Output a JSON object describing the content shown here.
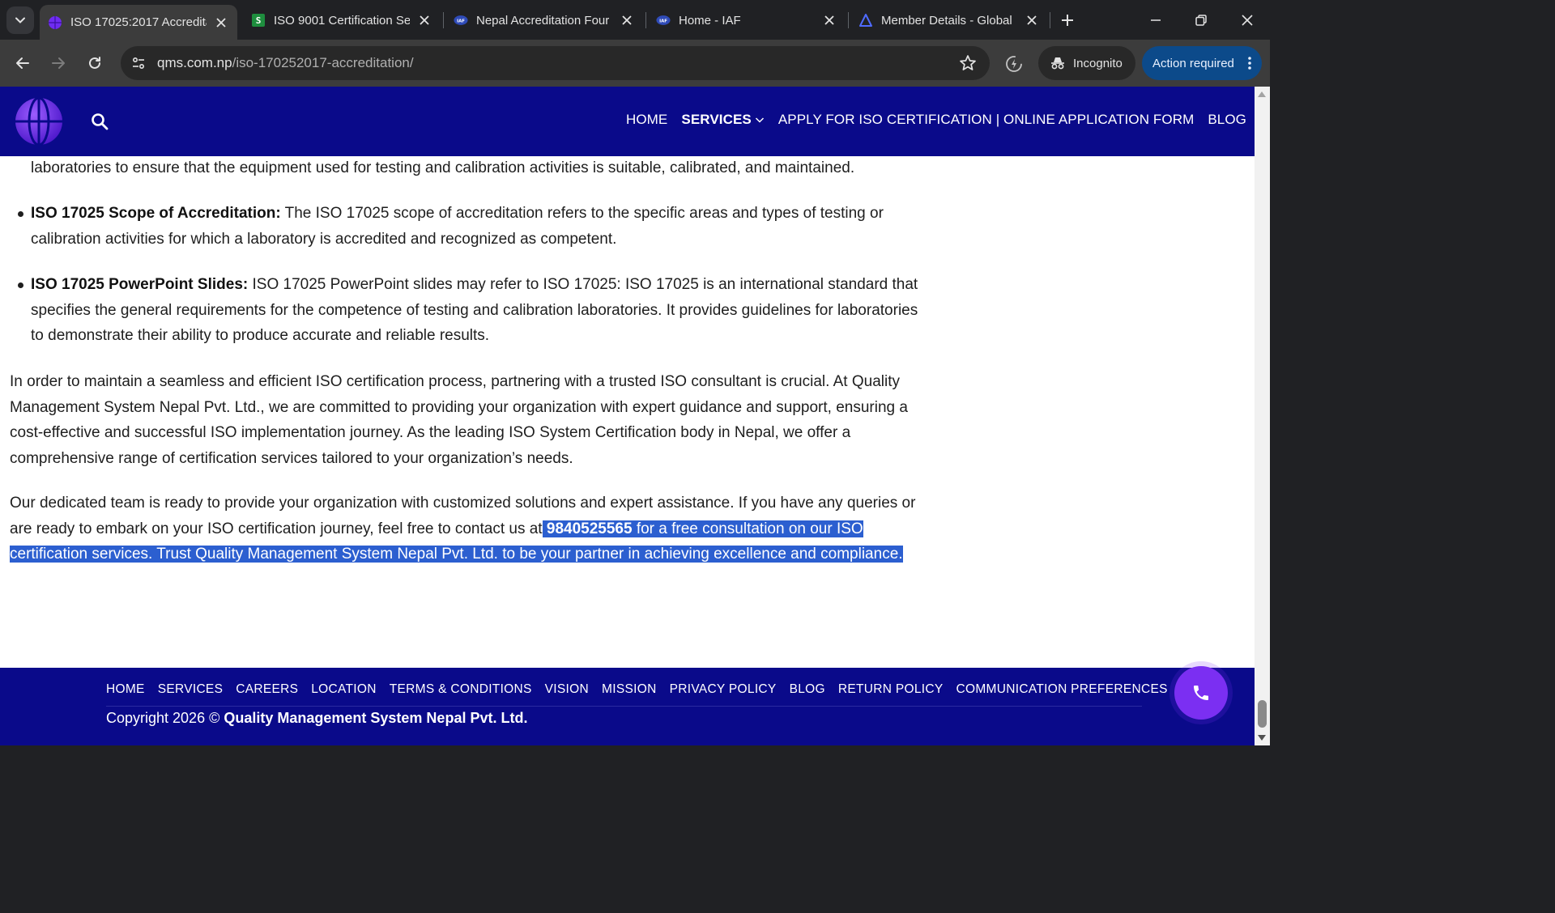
{
  "browser": {
    "tabs": [
      {
        "title": "ISO 17025:2017 Accredita",
        "active": true,
        "favicon": "globe-purple-icon"
      },
      {
        "title": "ISO 9001 Certification Se",
        "active": false,
        "favicon": "sheets-green-icon"
      },
      {
        "title": "Nepal Accreditation Four",
        "active": false,
        "favicon": "iaf-icon"
      },
      {
        "title": "Home - IAF",
        "active": false,
        "favicon": "iaf-icon"
      },
      {
        "title": "Member Details - Global",
        "active": false,
        "favicon": "global-a-icon"
      }
    ],
    "url_host": "qms.com.np",
    "url_path": "/iso-170252017-accreditation/",
    "incognito_label": "Incognito",
    "action_label": "Action required"
  },
  "site": {
    "nav": {
      "home": "HOME",
      "services": "SERVICES",
      "apply": "APPLY FOR ISO CERTIFICATION | ONLINE APPLICATION FORM",
      "blog": "BLOG"
    },
    "content": {
      "cut_line": "laboratories to ensure that the equipment used for testing and calibration activities is suitable, calibrated, and maintained.",
      "bullet1_term": "ISO 17025 Scope of Accreditation:",
      "bullet1_text": " The ISO 17025 scope of accreditation refers to the specific areas and types of testing or calibration activities for which a laboratory is accredited and recognized as competent.",
      "bullet2_term": "ISO 17025 PowerPoint Slides:",
      "bullet2_text": " ISO 17025 PowerPoint slides may refer to ISO 17025: ISO 17025 is an international standard that specifies the general requirements for the competence of testing and calibration laboratories. It provides guidelines for laboratories to demonstrate their ability to produce accurate and reliable results.",
      "para1": "In order to maintain a seamless and efficient ISO certification process, partnering with a trusted ISO consultant is crucial. At Quality Management System Nepal Pvt. Ltd., we are committed to providing your organization with expert guidance and support, ensuring a cost-effective and successful ISO implementation journey. As the leading ISO System Certification body in Nepal, we offer a comprehensive range of certification services tailored to your organization’s needs.",
      "para2_start": "Our dedicated team is ready to provide your organization with customized solutions and expert assistance. If you have any queries or are ready to embark on your ISO certification journey, feel free to contact us at",
      "para2_phone": "9840525565",
      "para2_end": " for a free consultation on our ISO certification services. Trust Quality Management System Nepal Pvt. Ltd. to be your partner in achieving excellence and compliance."
    },
    "footer": {
      "links": [
        "HOME",
        "SERVICES",
        "CAREERS",
        "LOCATION",
        "TERMS & CONDITIONS",
        "VISION",
        "MISSION",
        "PRIVACY POLICY",
        "BLOG",
        "RETURN POLICY",
        "COMMUNICATION PREFERENCES"
      ],
      "copyright_prefix": "Copyright 2026 © ",
      "company": "Quality Management System Nepal Pvt. Ltd."
    }
  },
  "colors": {
    "site_blue": "#0a0a8a",
    "selection": "#2c5fd0",
    "call_button": "#7b2ff2"
  }
}
